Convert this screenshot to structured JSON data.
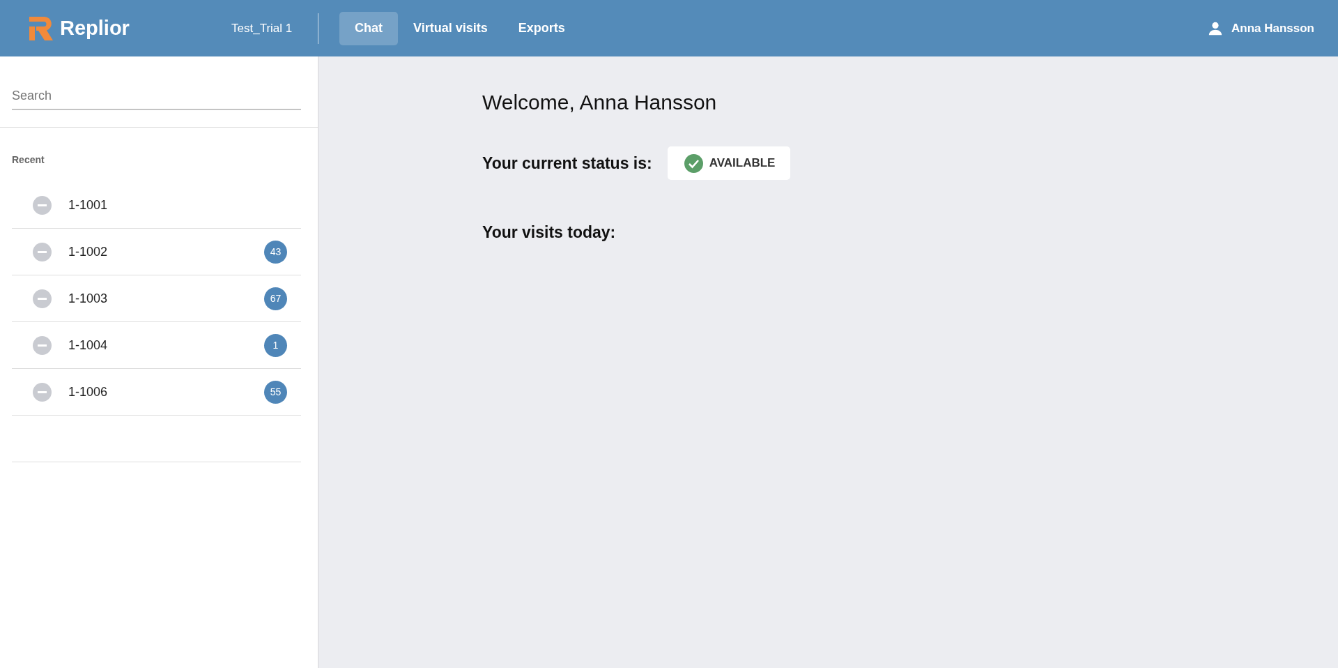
{
  "header": {
    "logo": "Replior",
    "workspace": "Test_Trial 1",
    "tabs": [
      {
        "label": "Chat",
        "selected": true
      },
      {
        "label": "Virtual visits",
        "selected": false
      },
      {
        "label": "Exports",
        "selected": false
      }
    ],
    "user": "Anna Hansson"
  },
  "sidebar": {
    "search": {
      "placeholder": "Search"
    },
    "section": "Recent",
    "items": [
      {
        "name": "1-1001",
        "kind": "offline"
      },
      {
        "name": "1-1002",
        "kind": "offline",
        "badge": "43"
      },
      {
        "name": "1-1003",
        "kind": "offline",
        "badge": "67"
      },
      {
        "name": "1-1004",
        "kind": "offline",
        "badge": "1"
      },
      {
        "name": "1-1006",
        "kind": "offline",
        "badge": "55"
      }
    ]
  },
  "main": {
    "welcome": "Welcome, Anna Hansson",
    "status_label": "Your current status is:",
    "status": {
      "label": "AVAILABLE",
      "kind": "available"
    },
    "visits_label": "Your visits today:"
  }
}
